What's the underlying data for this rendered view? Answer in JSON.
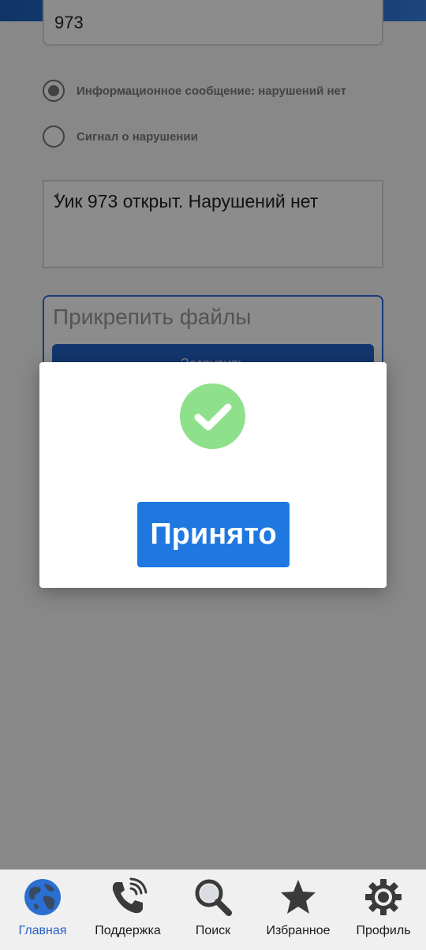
{
  "form": {
    "uik_value": "973",
    "radio_options": [
      {
        "label": "Информационное сообщение: нарушений нет",
        "selected": true
      },
      {
        "label": "Сигнал о нарушении",
        "selected": false
      }
    ],
    "message_text": "Уик 973 открыт. Нарушений нет",
    "attach_title": "Прикрепить файлы",
    "upload_label": "Загрузить"
  },
  "dialog": {
    "icon": "checkmark-icon",
    "button_label": "Принято"
  },
  "bottom_nav": [
    {
      "label": "Главная",
      "icon": "globe-icon",
      "active": true
    },
    {
      "label": "Поддержка",
      "icon": "phone-icon",
      "active": false
    },
    {
      "label": "Поиск",
      "icon": "search-icon",
      "active": false
    },
    {
      "label": "Избранное",
      "icon": "star-icon",
      "active": false
    },
    {
      "label": "Профиль",
      "icon": "gear-icon",
      "active": false
    }
  ],
  "colors": {
    "accent": "#1f78e0",
    "success": "#8ee08a",
    "nav_active": "#2762c4"
  }
}
